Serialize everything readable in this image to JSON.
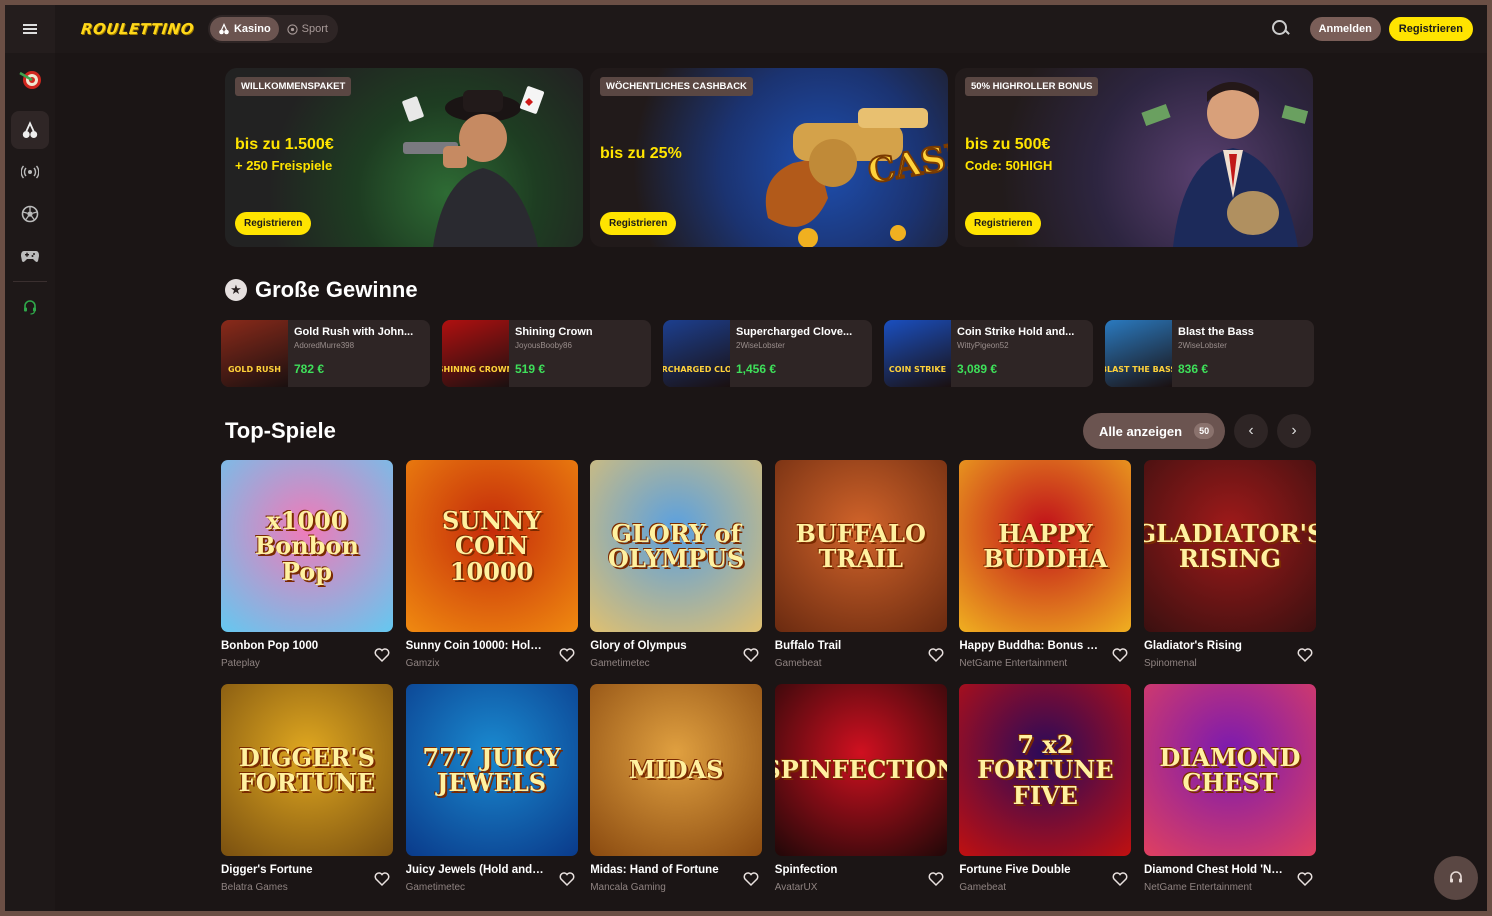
{
  "header": {
    "logo": "ROULETTINO",
    "tabs": [
      {
        "label": "Kasino",
        "icon": "cherry-icon",
        "active": true
      },
      {
        "label": "Sport",
        "icon": "soccer-ball-icon",
        "active": false
      }
    ],
    "login_label": "Anmelden",
    "register_label": "Registrieren"
  },
  "sidebar": {
    "items": [
      {
        "icon": "dartboard-icon"
      },
      {
        "icon": "cherry-icon",
        "active": true
      },
      {
        "icon": "live-broadcast-icon"
      },
      {
        "icon": "soccer-ball-icon"
      },
      {
        "icon": "gamepad-icon"
      },
      {
        "icon": "headset-icon"
      }
    ]
  },
  "banners": [
    {
      "tag": "WILLKOMMENSPAKET",
      "headline": "bis zu 1.500€",
      "sub": "+ 250 Freispiele",
      "cta": "Registrieren"
    },
    {
      "tag": "WÖCHENTLICHES CASHBACK",
      "headline": "bis zu 25%",
      "sub": "",
      "cta": "Registrieren",
      "art_text": "CASH BACK"
    },
    {
      "tag": "50% HIGHROLLER BONUS",
      "headline": "bis zu 500€",
      "sub": "Code: 50HIGH",
      "cta": "Registrieren"
    }
  ],
  "big_wins": {
    "title": "Große Gewinne",
    "items": [
      {
        "game": "Gold Rush with John...",
        "user": "AdoredMurre398",
        "amount": "782 €",
        "thumb_text": "GOLD RUSH",
        "color": "#8a2a1a"
      },
      {
        "game": "Shining Crown",
        "user": "JoyousBooby86",
        "amount": "519 €",
        "thumb_text": "SHINING CROWN",
        "color": "#b01010"
      },
      {
        "game": "Supercharged Clove...",
        "user": "2WiseLobster",
        "amount": "1,456 €",
        "thumb_text": "SUPERCHARGED CLOVERS",
        "color": "#1c3f8f"
      },
      {
        "game": "Coin Strike Hold and...",
        "user": "WittyPigeon52",
        "amount": "3,089 €",
        "thumb_text": "COIN STRIKE",
        "color": "#1a4fc0"
      },
      {
        "game": "Blast the Bass",
        "user": "2WiseLobster",
        "amount": "836 €",
        "thumb_text": "BLAST THE BASS",
        "color": "#2a7ac0"
      }
    ]
  },
  "top_games": {
    "title": "Top-Spiele",
    "show_all_label": "Alle anzeigen",
    "count": "50",
    "games": [
      {
        "name": "Bonbon Pop 1000",
        "provider": "Pateplay",
        "thumb_text": "x1000 Bonbon Pop",
        "bg": "#f07ab8",
        "bg2": "#64c8f0"
      },
      {
        "name": "Sunny Coin 10000: Hold ...",
        "provider": "Gamzix",
        "thumb_text": "SUNNY COIN 10000",
        "bg": "#c42a0a",
        "bg2": "#f08a10"
      },
      {
        "name": "Glory of Olympus",
        "provider": "Gametimetec",
        "thumb_text": "GLORY of OLYMPUS",
        "bg": "#5aa0e0",
        "bg2": "#e0c070"
      },
      {
        "name": "Buffalo Trail",
        "provider": "Gamebeat",
        "thumb_text": "BUFFALO TRAIL",
        "bg": "#d2642a",
        "bg2": "#6a2a10"
      },
      {
        "name": "Happy Buddha: Bonus C...",
        "provider": "NetGame Entertainment",
        "thumb_text": "HAPPY BUDDHA",
        "bg": "#c0101a",
        "bg2": "#f0b020"
      },
      {
        "name": "Gladiator's Rising",
        "provider": "Spinomenal",
        "thumb_text": "GLADIATOR'S RISING",
        "bg": "#a01a1a",
        "bg2": "#3a1010"
      },
      {
        "name": "Digger's Fortune",
        "provider": "Belatra Games",
        "thumb_text": "DIGGER'S FORTUNE",
        "bg": "#e0a820",
        "bg2": "#7a5010"
      },
      {
        "name": "Juicy Jewels (Hold and L...",
        "provider": "Gametimetec",
        "thumb_text": "777 JUICY JEWELS",
        "bg": "#1a8ad0",
        "bg2": "#0a3a8a"
      },
      {
        "name": "Midas: Hand of Fortune",
        "provider": "Mancala Gaming",
        "thumb_text": "MIDAS",
        "bg": "#e0a040",
        "bg2": "#8a4a10"
      },
      {
        "name": "Spinfection",
        "provider": "AvatarUX",
        "thumb_text": "SPINFECTION",
        "bg": "#d01020",
        "bg2": "#200808"
      },
      {
        "name": "Fortune Five Double",
        "provider": "Gamebeat",
        "thumb_text": "7 x2 FORTUNE FIVE",
        "bg": "#2a0a5a",
        "bg2": "#c01010"
      },
      {
        "name": "Diamond Chest Hold 'N' ...",
        "provider": "NetGame Entertainment",
        "thumb_text": "DIAMOND CHEST",
        "bg": "#7a1ab0",
        "bg2": "#e04060"
      }
    ]
  },
  "colors": {
    "accent": "#ffe400",
    "win_green": "#3ee05a",
    "background": "#1b1515"
  }
}
